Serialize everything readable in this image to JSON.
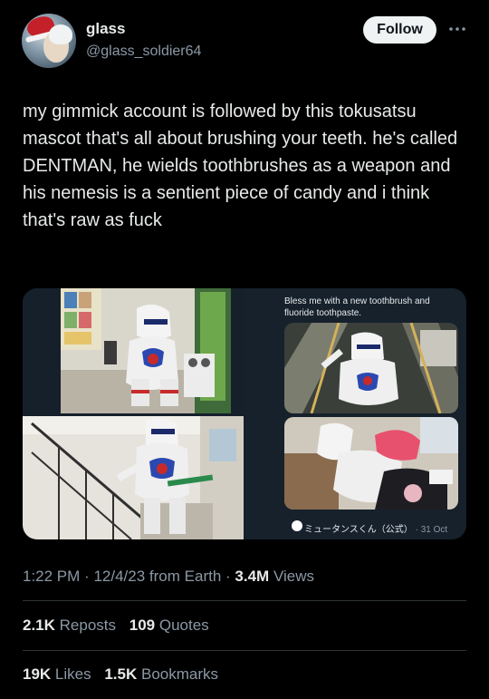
{
  "author": {
    "display_name": "glass",
    "handle": "@glass_soldier64",
    "follow_label": "Follow",
    "more_icon": "more-horizontal-icon"
  },
  "tweet": {
    "text": "my gimmick account is followed by this tokusatsu mascot that's all about brushing your teeth. he's called DENTMAN, he wields toothbrushes as a weapon and his nemesis is a sentient piece of candy and i think that's raw as fuck"
  },
  "quoted": {
    "text": "Bless me with a new toothbrush and fluoride toothpaste.",
    "author": "ミュータンスくん（公式）",
    "separator": "·",
    "date": "31 Oct"
  },
  "meta": {
    "time": "1:22 PM",
    "date": "12/4/23",
    "source": "from Earth",
    "views_count": "3.4M",
    "views_label": "Views",
    "separator": "·"
  },
  "engagement": {
    "reposts_count": "2.1K",
    "reposts_label": "Reposts",
    "quotes_count": "109",
    "quotes_label": "Quotes",
    "likes_count": "19K",
    "likes_label": "Likes",
    "bookmarks_count": "1.5K",
    "bookmarks_label": "Bookmarks"
  }
}
